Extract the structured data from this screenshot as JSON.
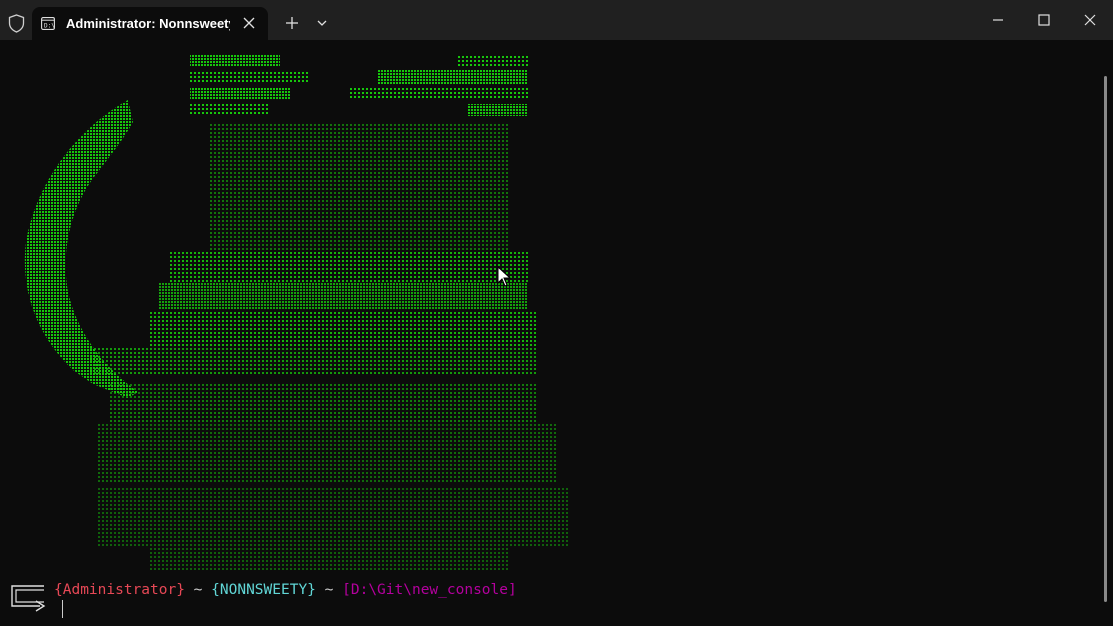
{
  "titlebar": {
    "tab_title": "Administrator:  Nonnsweety |",
    "icons": {
      "shield": "shield-icon",
      "tab": "terminal-icon",
      "close_tab": "close-icon",
      "new_tab": "plus-icon",
      "dropdown": "chevron-down-icon",
      "minimize": "minimize-icon",
      "maximize": "maximize-icon",
      "close_window": "close-icon"
    }
  },
  "prompt": {
    "user": "{Administrator}",
    "sep1": " ~ ",
    "host": "{NONNSWEETY}",
    "sep2": " ~ ",
    "path": "[D:\\Git\\new_console]"
  },
  "colors": {
    "background": "#0c0c0c",
    "titlebar": "#202020",
    "ascii_green": "#16c60c",
    "user": "#e74856",
    "host": "#61d6d6",
    "path": "#b4009e",
    "separator": "#cccccc"
  }
}
